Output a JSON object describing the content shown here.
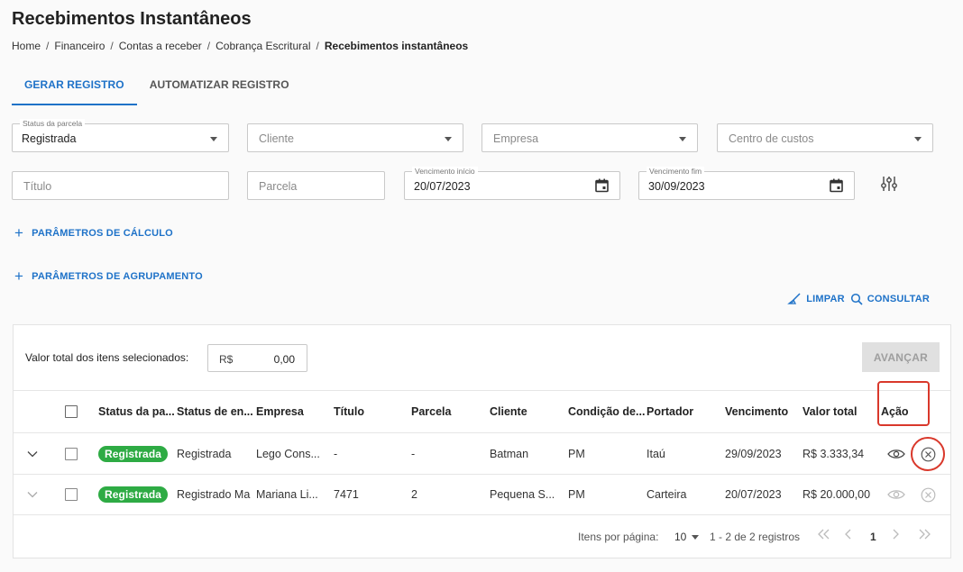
{
  "page": {
    "title": "Recebimentos Instantâneos",
    "breadcrumb": [
      "Home",
      "Financeiro",
      "Contas a receber",
      "Cobrança Escritural",
      "Recebimentos instantâneos"
    ]
  },
  "tabs": [
    {
      "label": "GERAR REGISTRO",
      "active": true
    },
    {
      "label": "AUTOMATIZAR REGISTRO",
      "active": false
    }
  ],
  "filters": {
    "status_parcela": {
      "label": "Status da parcela",
      "value": "Registrada"
    },
    "cliente": {
      "placeholder": "Cliente"
    },
    "empresa": {
      "placeholder": "Empresa"
    },
    "centro_custos": {
      "placeholder": "Centro de custos"
    },
    "titulo": {
      "placeholder": "Título"
    },
    "parcela": {
      "placeholder": "Parcela"
    },
    "vencimento_inicio": {
      "label": "Vencimento início",
      "value": "20/07/2023"
    },
    "vencimento_fim": {
      "label": "Vencimento fim",
      "value": "30/09/2023"
    }
  },
  "sections": {
    "calculo": "PARÂMETROS DE CÁLCULO",
    "agrupamento": "PARÂMETROS DE AGRUPAMENTO"
  },
  "actions": {
    "limpar": "LIMPAR",
    "consultar": "CONSULTAR"
  },
  "summary": {
    "label": "Valor total dos itens selecionados:",
    "currency": "R$",
    "value": "0,00",
    "avancar": "AVANÇAR"
  },
  "table": {
    "headers": {
      "status_parcela": "Status da pa...",
      "status_envio": "Status de en...",
      "empresa": "Empresa",
      "titulo": "Título",
      "parcela": "Parcela",
      "cliente": "Cliente",
      "condicao": "Condição de...",
      "portador": "Portador",
      "vencimento": "Vencimento",
      "valor_total": "Valor total",
      "acao": "Ação"
    },
    "rows": [
      {
        "status": "Registrada",
        "status_envio": "Registrada",
        "empresa": "Lego Cons...",
        "titulo": "-",
        "parcela": "-",
        "cliente": "Batman",
        "condicao": "PM",
        "portador": "Itaú",
        "vencimento": "29/09/2023",
        "valor_total": "R$ 3.333,34"
      },
      {
        "status": "Registrada",
        "status_envio": "Registrado Ma",
        "empresa": "Mariana Li...",
        "titulo": "7471",
        "parcela": "2",
        "cliente": "Pequena S...",
        "condicao": "PM",
        "portador": "Carteira",
        "vencimento": "20/07/2023",
        "valor_total": "R$ 20.000,00"
      }
    ]
  },
  "pagination": {
    "label": "Itens por página:",
    "per_page": "10",
    "range": "1 - 2 de 2 registros",
    "current_page": "1"
  },
  "colors": {
    "accent": "#1e72c8",
    "badge": "#2eab44",
    "highlight": "#d9382b"
  }
}
